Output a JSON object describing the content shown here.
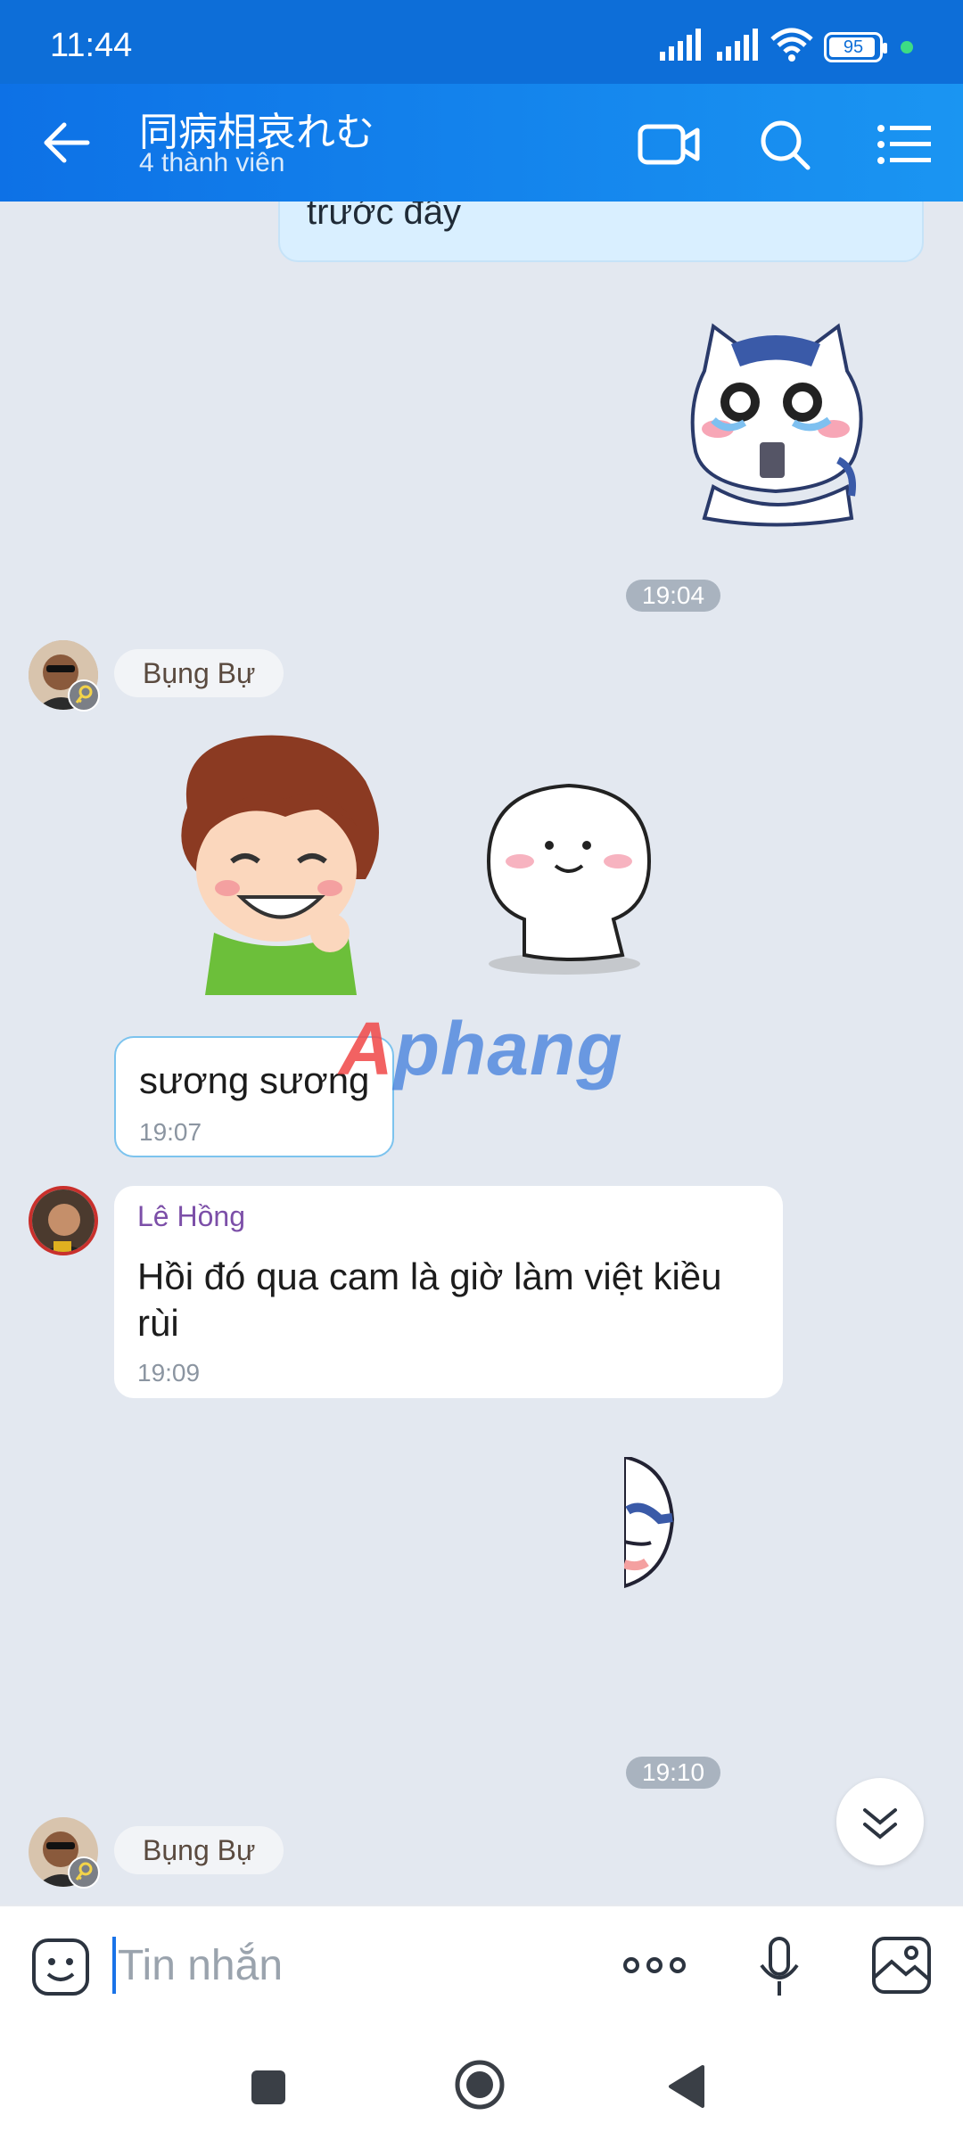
{
  "status_bar": {
    "time": "11:44",
    "battery": "95"
  },
  "header": {
    "title": "同病相哀れむ",
    "subtitle": "4 thành viên"
  },
  "messages": {
    "partial_text": "trước đây",
    "time_1": "19:04",
    "sender_1": "Bụng Bự",
    "bubble_1": {
      "text": "sương sương",
      "time": "19:07"
    },
    "bubble_2": {
      "sender": "Lê Hồng",
      "text": "Hồi đó qua cam là giờ làm việt kiều rùi",
      "time": "19:09"
    },
    "time_2": "19:10",
    "sender_2": "Bụng Bự"
  },
  "watermark": {
    "first": "A",
    "rest": "phang"
  },
  "composer": {
    "placeholder": "Tin nhắn"
  },
  "colors": {
    "header": "#1a8cf0",
    "status_bar": "#0d6ed8",
    "background": "#e3e8f0",
    "accent": "#1a73e8"
  }
}
